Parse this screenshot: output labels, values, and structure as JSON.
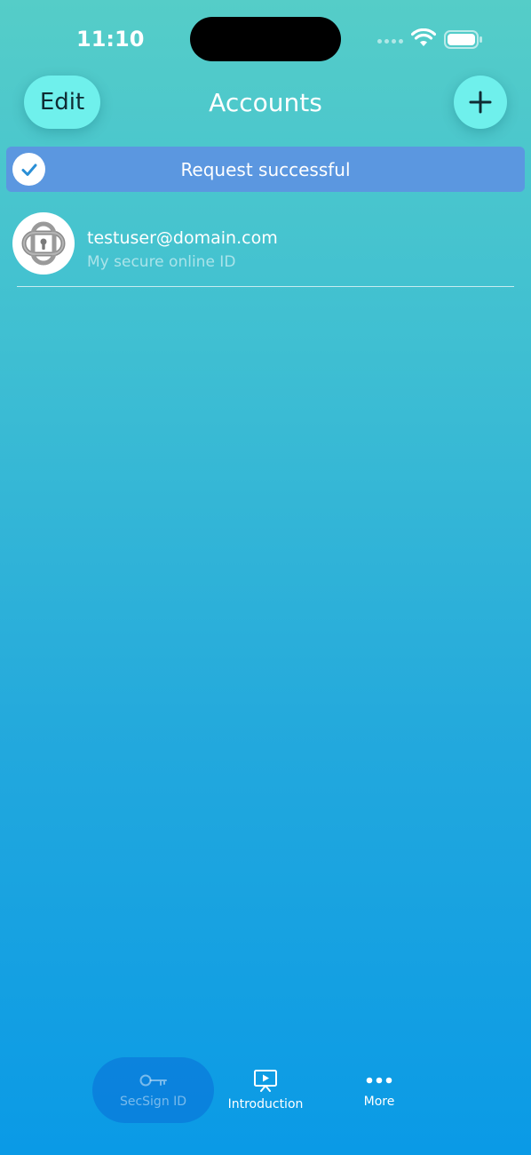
{
  "status_bar": {
    "time": "11:10"
  },
  "nav": {
    "edit_label": "Edit",
    "title": "Accounts",
    "add_icon": "plus-icon"
  },
  "banner": {
    "message": "Request successful",
    "icon": "checkmark-icon",
    "color": "#5b97e0"
  },
  "accounts": [
    {
      "email": "testuser@domain.com",
      "description": "My secure online ID",
      "icon": "secsign-lock-logo"
    }
  ],
  "tabs": [
    {
      "label": "SecSign ID",
      "icon": "key-icon",
      "selected": true
    },
    {
      "label": "Introduction",
      "icon": "presentation-play-icon",
      "selected": false
    },
    {
      "label": "More",
      "icon": "more-dots-icon",
      "selected": false
    }
  ],
  "colors": {
    "accent_button": "#6ff0ec",
    "gradient_top": "#55cdc8",
    "gradient_bottom": "#0a9ae6"
  }
}
